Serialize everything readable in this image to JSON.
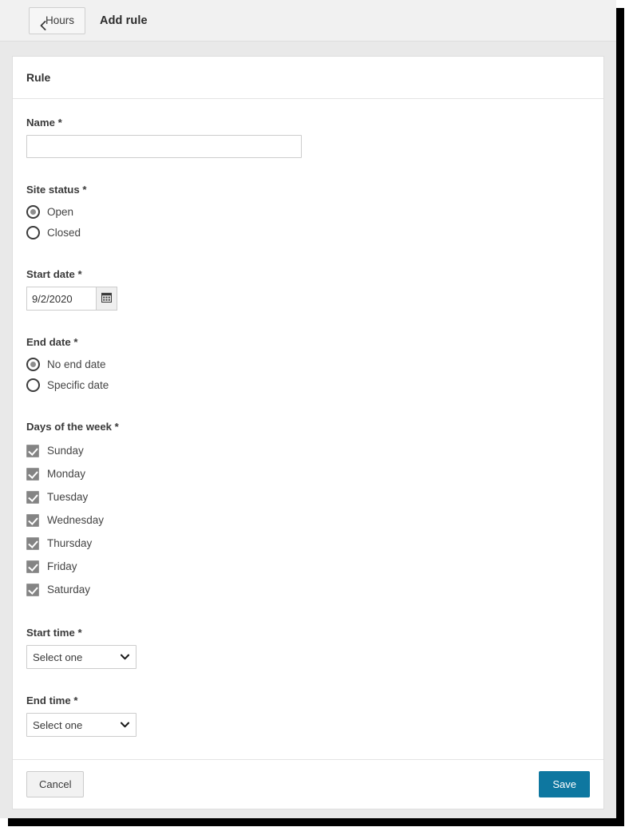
{
  "window": {
    "topbar": {
      "back_button": {
        "label": "Hours",
        "icon": "chevron-left-icon"
      },
      "title": "Add rule"
    }
  },
  "panel": {
    "title": "Rule",
    "fields": {
      "name": {
        "label": "Name *",
        "value": "",
        "placeholder": ""
      },
      "site_status": {
        "label": "Site status *",
        "options": [
          {
            "label": "Open",
            "selected": true
          },
          {
            "label": "Closed",
            "selected": false
          }
        ]
      },
      "start_date": {
        "label": "Start date *",
        "value": "9/2/2020",
        "calendar_icon": "calendar-icon"
      },
      "end_date": {
        "label": "End date *",
        "options": [
          {
            "label": "No end date",
            "selected": true
          },
          {
            "label": "Specific date",
            "selected": false
          }
        ]
      },
      "days_of_week": {
        "label": "Days of the week *",
        "options": [
          {
            "label": "Sunday",
            "checked": true
          },
          {
            "label": "Monday",
            "checked": true
          },
          {
            "label": "Tuesday",
            "checked": true
          },
          {
            "label": "Wednesday",
            "checked": true
          },
          {
            "label": "Thursday",
            "checked": true
          },
          {
            "label": "Friday",
            "checked": true
          },
          {
            "label": "Saturday",
            "checked": true
          }
        ]
      },
      "start_time": {
        "label": "Start time *",
        "value": "Select one"
      },
      "end_time": {
        "label": "End time *",
        "value": "Select one"
      }
    },
    "footer": {
      "cancel_label": "Cancel",
      "save_label": "Save"
    }
  },
  "colors": {
    "accent": "#0e77a0",
    "topbar_bg": "#f1f1f1",
    "page_bg": "#e9e9e9",
    "panel_bg": "#ffffff",
    "border": "#dedede",
    "checkbox_fill": "#848484",
    "radio_dot": "#8d8d8d"
  }
}
